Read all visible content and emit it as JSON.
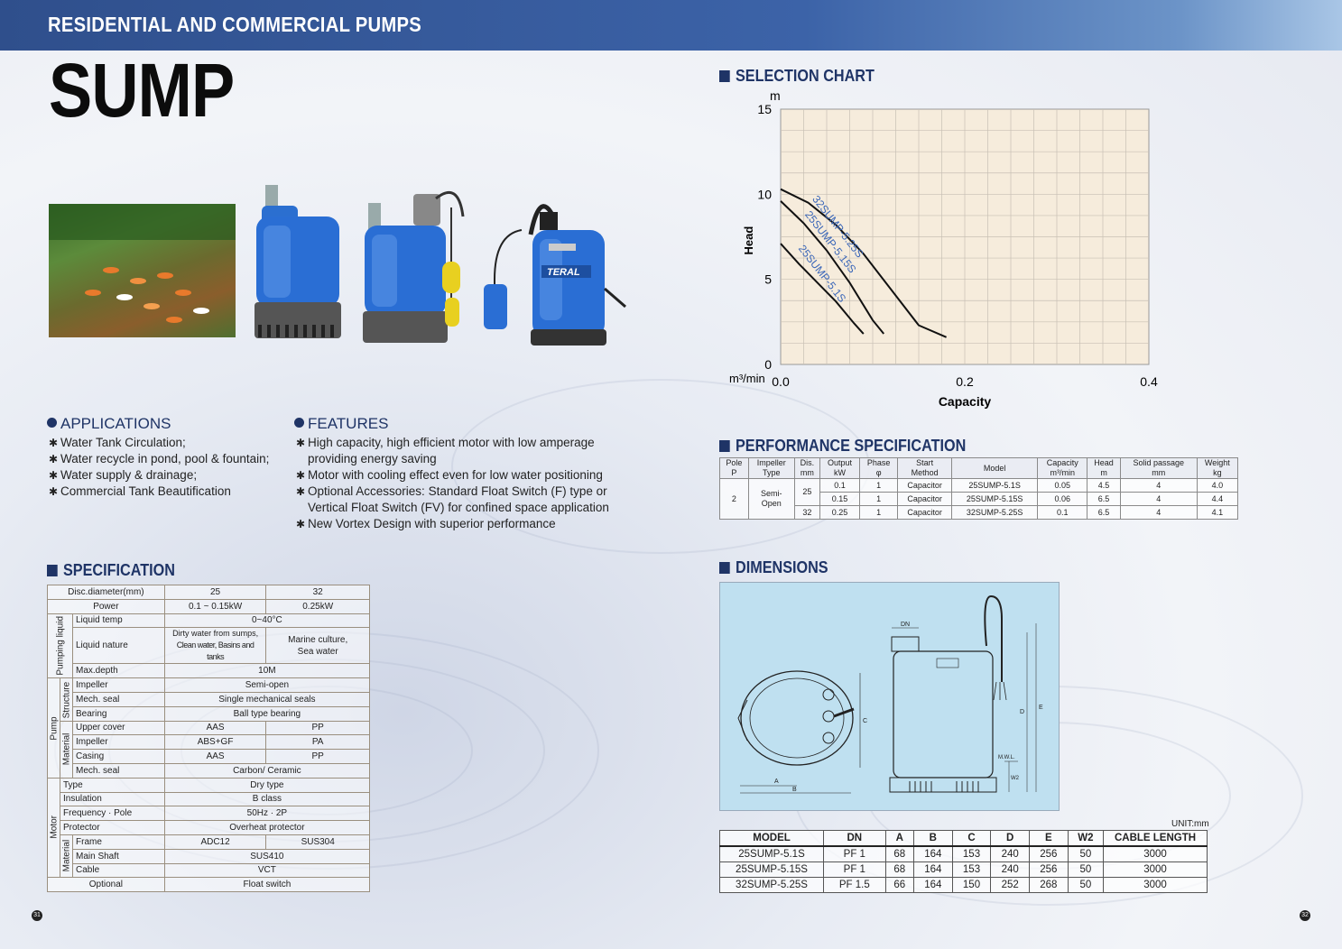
{
  "header": {
    "category": "RESIDENTIAL AND COMMERCIAL PUMPS",
    "title": "SUMP"
  },
  "photos": {
    "logo_text": "TERAL"
  },
  "applications": {
    "title": "APPLICATIONS",
    "items": [
      "Water Tank Circulation;",
      "Water recycle in pond, pool & fountain;",
      "Water supply & drainage;",
      "Commercial Tank Beautification"
    ]
  },
  "features": {
    "title": "FEATURES",
    "items": [
      [
        "High capacity, high efficient motor with low amperage",
        "providing energy saving"
      ],
      [
        "Motor with cooling effect even for low water positioning"
      ],
      [
        "Optional Accessories: Standard Float Switch (F) type or",
        "Vertical Float Switch (FV) for confined space application"
      ],
      [
        "New Vortex Design with superior performance"
      ]
    ]
  },
  "specification": {
    "title": "SPECIFICATION",
    "groups": {
      "pumping_liquid": "Pumping liquid",
      "pump": "Pump",
      "structure": "Structure",
      "material": "Material",
      "motor": "Motor",
      "motor_material": "Material"
    },
    "disc_label": "Disc.diameter(mm)",
    "disc_25": "25",
    "disc_32": "32",
    "power_label": "Power",
    "power_25": "0.1 ~ 0.15kW",
    "power_32": "0.25kW",
    "liquid_temp_label": "Liquid temp",
    "liquid_temp": "0~40°C",
    "liquid_nature_label": "Liquid nature",
    "liquid_nature_25a": "Dirty water from sumps,",
    "liquid_nature_25b": "Clean water, Basins and tanks",
    "liquid_nature_32a": "Marine culture,",
    "liquid_nature_32b": "Sea water",
    "max_depth_label": "Max.depth",
    "max_depth": "10M",
    "impeller_label": "Impeller",
    "impeller": "Semi-open",
    "mech_seal_label": "Mech. seal",
    "mech_seal": "Single mechanical seals",
    "bearing_label": "Bearing",
    "bearing": "Ball type bearing",
    "upper_cover_label": "Upper cover",
    "upper_cover_25": "AAS",
    "upper_cover_32": "PP",
    "impeller_mat_label": "Impeller",
    "impeller_mat_25": "ABS+GF",
    "impeller_mat_32": "PA",
    "casing_label": "Casing",
    "casing_25": "AAS",
    "casing_32": "PP",
    "mech_seal_mat_label": "Mech. seal",
    "mech_seal_mat": "Carbon/ Ceramic",
    "type_label": "Type",
    "type": "Dry type",
    "insulation_label": "Insulation",
    "insulation": "B class",
    "freq_label": "Frequency · Pole",
    "freq": "50Hz · 2P",
    "protector_label": "Protector",
    "protector": "Overheat protector",
    "frame_label": "Frame",
    "frame_25": "ADC12",
    "frame_32": "SUS304",
    "shaft_label": "Main Shaft",
    "shaft": "SUS410",
    "cable_label": "Cable",
    "cable": "VCT",
    "optional_label": "Optional",
    "optional": "Float switch"
  },
  "selection_chart": {
    "title": "SELECTION CHART",
    "y_unit": "m",
    "y_label": "Head",
    "x_unit": "m³/min",
    "x_label": "Capacity",
    "x_ticks": [
      "0.0",
      "0.2",
      "0.4"
    ],
    "y_ticks": [
      "0",
      "5",
      "10",
      "15"
    ]
  },
  "chart_data": {
    "type": "line",
    "xlabel": "Capacity",
    "ylabel": "Head",
    "xlim": [
      0,
      0.4
    ],
    "ylim": [
      0,
      15
    ],
    "grid": true,
    "series": [
      {
        "name": "32SUMP-5.25S",
        "x": [
          0,
          0.03,
          0.06,
          0.09,
          0.12,
          0.15,
          0.18
        ],
        "y": [
          10.3,
          9.5,
          8.2,
          6.5,
          4.4,
          2.3,
          1.6
        ]
      },
      {
        "name": "25SUMP-5.15S",
        "x": [
          0,
          0.025,
          0.05,
          0.075,
          0.1,
          0.112
        ],
        "y": [
          9.6,
          8.3,
          6.7,
          4.8,
          2.6,
          1.8
        ]
      },
      {
        "name": "25SUMP-5.1S",
        "x": [
          0,
          0.02,
          0.04,
          0.06,
          0.08,
          0.09
        ],
        "y": [
          7.1,
          5.9,
          4.8,
          3.7,
          2.4,
          1.8
        ]
      }
    ]
  },
  "performance": {
    "title": "PERFORMANCE SPECIFICATION",
    "headers": [
      [
        "Pole",
        "P"
      ],
      [
        "Impeller",
        "Type"
      ],
      [
        "Dis.",
        "mm"
      ],
      [
        "Output",
        "kW"
      ],
      [
        "Phase",
        "φ"
      ],
      [
        "Start",
        "Method"
      ],
      [
        "Model",
        ""
      ],
      [
        "Capacity",
        "m³/min"
      ],
      [
        "Head",
        "m"
      ],
      [
        "Solid passage",
        "mm"
      ],
      [
        "Weight",
        "kg"
      ]
    ],
    "pole": "2",
    "impeller_a": "Semi-",
    "impeller_b": "Open",
    "dis_25": "25",
    "dis_32": "32",
    "rows": [
      {
        "output": "0.1",
        "phase": "1",
        "start": "Capacitor",
        "model": "25SUMP-5.1S",
        "capacity": "0.05",
        "head": "4.5",
        "solid": "4",
        "weight": "4.0"
      },
      {
        "output": "0.15",
        "phase": "1",
        "start": "Capacitor",
        "model": "25SUMP-5.15S",
        "capacity": "0.06",
        "head": "6.5",
        "solid": "4",
        "weight": "4.4"
      },
      {
        "output": "0.25",
        "phase": "1",
        "start": "Capacitor",
        "model": "32SUMP-5.25S",
        "capacity": "0.1",
        "head": "6.5",
        "solid": "4",
        "weight": "4.1"
      }
    ]
  },
  "dimensions": {
    "title": "DIMENSIONS",
    "drawing_labels": {
      "dn": "DN",
      "a": "A",
      "b": "B",
      "c": "C",
      "d": "D",
      "e": "E",
      "mwl": "M.W.L.",
      "w2": "W2"
    },
    "unit": "UNIT:mm",
    "headers": [
      "MODEL",
      "DN",
      "A",
      "B",
      "C",
      "D",
      "E",
      "W2",
      "CABLE LENGTH"
    ],
    "rows": [
      [
        "25SUMP-5.1S",
        "PF 1",
        "68",
        "164",
        "153",
        "240",
        "256",
        "50",
        "3000"
      ],
      [
        "25SUMP-5.15S",
        "PF 1",
        "68",
        "164",
        "153",
        "240",
        "256",
        "50",
        "3000"
      ],
      [
        "32SUMP-5.25S",
        "PF 1.5",
        "66",
        "164",
        "150",
        "252",
        "268",
        "50",
        "3000"
      ]
    ]
  },
  "pages": {
    "left": "31",
    "right": "32"
  }
}
